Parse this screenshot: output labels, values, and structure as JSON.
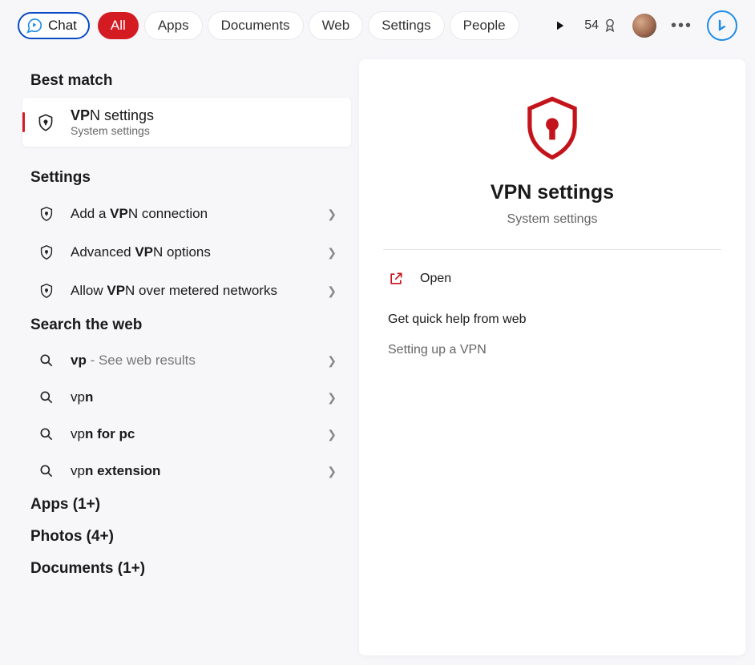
{
  "colors": {
    "accent": "#d41b22",
    "blue": "#1f8ce6"
  },
  "topbar": {
    "chat_label": "Chat",
    "tabs": [
      {
        "label": "All",
        "active": true
      },
      {
        "label": "Apps",
        "active": false
      },
      {
        "label": "Documents",
        "active": false
      },
      {
        "label": "Web",
        "active": false
      },
      {
        "label": "Settings",
        "active": false
      },
      {
        "label": "People",
        "active": false
      }
    ],
    "rewards_points": "54"
  },
  "left": {
    "best_match_heading": "Best match",
    "best_match": {
      "title_bold": "VP",
      "title_rest": "N settings",
      "subtitle": "System settings"
    },
    "settings_heading": "Settings",
    "settings_items": [
      {
        "prefix": "Add a ",
        "bold": "VP",
        "suffix": "N connection"
      },
      {
        "prefix": "Advanced ",
        "bold": "VP",
        "suffix": "N options"
      },
      {
        "prefix": "Allow ",
        "bold": "VP",
        "suffix": "N over metered networks"
      }
    ],
    "web_heading": "Search the web",
    "web_items": [
      {
        "prefix": "",
        "bold": "vp",
        "suffix": "",
        "trail": " - See web results"
      },
      {
        "prefix": "vp",
        "bold": "n",
        "suffix": "",
        "trail": ""
      },
      {
        "prefix": "vp",
        "bold": "n for pc",
        "suffix": "",
        "trail": ""
      },
      {
        "prefix": "vp",
        "bold": "n extension",
        "suffix": "",
        "trail": ""
      }
    ],
    "more_sections": [
      "Apps (1+)",
      "Photos (4+)",
      "Documents (1+)"
    ]
  },
  "right": {
    "hero_title": "VPN settings",
    "hero_subtitle": "System settings",
    "open_label": "Open",
    "help_heading": "Get quick help from web",
    "help_links": [
      "Setting up a VPN"
    ]
  }
}
